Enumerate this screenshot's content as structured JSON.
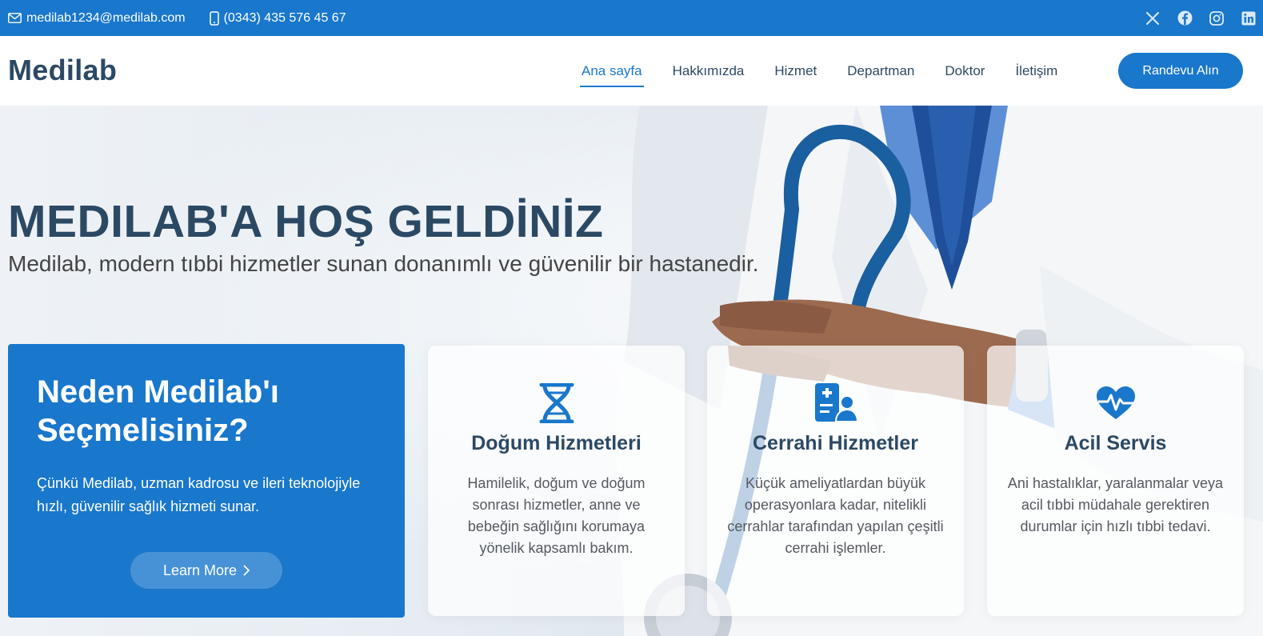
{
  "topbar": {
    "email": "medilab1234@medilab.com",
    "phone": "(0343) 435 576 45 67",
    "icons": [
      "envelope-icon",
      "phone-icon",
      "x-twitter-icon",
      "facebook-icon",
      "instagram-icon",
      "linkedin-icon"
    ]
  },
  "header": {
    "logo": "Medilab",
    "nav": [
      "Ana sayfa",
      "Hakkımızda",
      "Hizmet",
      "Departman",
      "Doktor",
      "İletişim"
    ],
    "active_nav": "Ana sayfa",
    "cta": "Randevu Alın"
  },
  "hero": {
    "title": "MEDILAB'A HOŞ GELDİNİZ",
    "subtitle": "Medilab, modern tıbbi hizmetler sunan donanımlı ve güvenilir bir hastanedir."
  },
  "why": {
    "title": "Neden Medilab'ı Seçmelisiniz?",
    "text": "Çünkü Medilab, uzman kadrosu ve ileri teknolojiyle hızlı, güvenilir sağlık hizmeti sunar.",
    "button": "Learn More"
  },
  "cards": [
    {
      "icon": "dna-icon",
      "title": "Doğum Hizmetleri",
      "text": "Hamilelik, doğum ve doğum sonrası hizmetler, anne ve bebeğin sağlığını korumaya yönelik kapsamlı bakım."
    },
    {
      "icon": "medical-clipboard-user-icon",
      "title": "Cerrahi Hizmetler",
      "text": "Küçük ameliyatlardan büyük operasyonlara kadar, nitelikli cerrahlar tarafından yapılan çeşitli cerrahi işlemler."
    },
    {
      "icon": "heart-pulse-icon",
      "title": "Acil Servis",
      "text": "Ani hastalıklar, yaralanmalar veya acil tıbbi müdahale gerektiren durumlar için hızlı tıbbi tedavi."
    }
  ],
  "colors": {
    "accent": "#1977cc",
    "heading": "#2c4964",
    "body_text": "#444444"
  }
}
